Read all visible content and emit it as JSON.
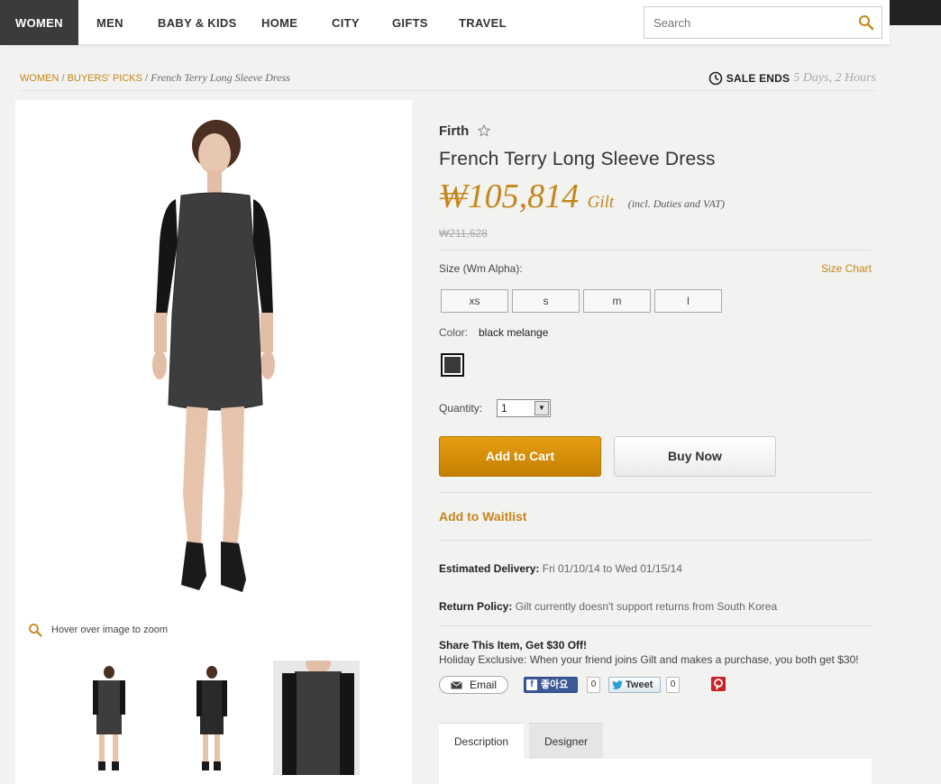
{
  "nav": {
    "items": [
      "WOMEN",
      "MEN",
      "BABY & KIDS",
      "HOME",
      "CITY",
      "GIFTS",
      "TRAVEL"
    ],
    "active": "WOMEN",
    "search_placeholder": "Search"
  },
  "breadcrumb": {
    "links": [
      "WOMEN",
      "BUYERS' PICKS"
    ],
    "separator": " / ",
    "current": "French Terry Long Sleeve Dress"
  },
  "sale": {
    "label": "SALE ENDS",
    "time": "5 Days, 2 Hours"
  },
  "image": {
    "zoom_hint": "Hover over image to zoom"
  },
  "product": {
    "brand": "Firth",
    "title": "French Terry Long Sleeve Dress",
    "price": "₩105,814",
    "price_suffix": "Gilt",
    "price_note": "(incl. Duties and VAT)",
    "original_price": "₩211,628",
    "size_label": "Size (Wm Alpha):",
    "size_chart": "Size Chart",
    "sizes": [
      "xs",
      "s",
      "m",
      "l"
    ],
    "color_label": "Color:",
    "color_value": "black melange",
    "swatch_color": "#3a3a3a",
    "quantity_label": "Quantity:",
    "quantity_value": "1",
    "add_to_cart": "Add to Cart",
    "buy_now": "Buy Now",
    "add_to_waitlist": "Add to Waitlist",
    "delivery_label": "Estimated Delivery:",
    "delivery_value": "Fri 01/10/14 to Wed 01/15/14",
    "return_label": "Return Policy:",
    "return_value": "Gilt currently doesn't support returns from South Korea",
    "share_title": "Share This Item, Get $30 Off!",
    "share_desc": "Holiday Exclusive: When your friend joins Gilt and makes a purchase, you both get $30!"
  },
  "share": {
    "email": "Email",
    "facebook": "좋아요",
    "facebook_count": "0",
    "tweet": "Tweet",
    "tweet_count": "0"
  },
  "tabs": [
    "Description",
    "Designer"
  ],
  "colors": {
    "accent": "#c4861b",
    "nav_active": "#3b3b3b",
    "cart_button": "#d88f0a"
  }
}
